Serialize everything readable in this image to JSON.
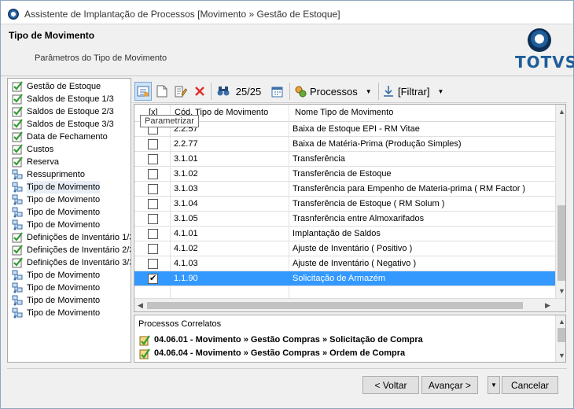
{
  "window": {
    "title": "Assistente de Implantação de Processos [Movimento » Gestão de Estoque]"
  },
  "header": {
    "title": "Tipo de Movimento",
    "subtitle": "Parâmetros do Tipo de Movimento",
    "logo_text": "TOTVS"
  },
  "steps": [
    {
      "label": "Gestão de Estoque",
      "icon": "check-icon"
    },
    {
      "label": "Saldos de Estoque 1/3",
      "icon": "check-icon"
    },
    {
      "label": "Saldos de Estoque 2/3",
      "icon": "check-icon"
    },
    {
      "label": "Saldos de Estoque 3/3",
      "icon": "check-icon"
    },
    {
      "label": "Data de Fechamento",
      "icon": "check-icon"
    },
    {
      "label": "Custos",
      "icon": "check-icon"
    },
    {
      "label": "Reserva",
      "icon": "check-icon"
    },
    {
      "label": "Ressuprimento",
      "icon": "step-icon"
    },
    {
      "label": "Tipo de Movimento",
      "icon": "step-icon",
      "active": true
    },
    {
      "label": "Tipo de Movimento",
      "icon": "step-icon"
    },
    {
      "label": "Tipo de Movimento",
      "icon": "step-icon"
    },
    {
      "label": "Tipo de Movimento",
      "icon": "step-icon"
    },
    {
      "label": "Definições de Inventário 1/3",
      "icon": "check-icon"
    },
    {
      "label": "Definições de Inventário 2/3",
      "icon": "check-icon"
    },
    {
      "label": "Definições de Inventário 3/3",
      "icon": "check-icon"
    },
    {
      "label": "Tipo de Movimento",
      "icon": "step-icon"
    },
    {
      "label": "Tipo de Movimento",
      "icon": "step-icon"
    },
    {
      "label": "Tipo de Movimento",
      "icon": "step-icon"
    },
    {
      "label": "Tipo de Movimento",
      "icon": "step-icon"
    }
  ],
  "toolbar": {
    "record_count": "25/25",
    "processos_label": "Processos",
    "filtrar_label": "[Filtrar]",
    "tooltip": "Parametrizar"
  },
  "grid": {
    "headers": {
      "check": "[x]",
      "code": "Cód. Tipo de Movimento",
      "name": "Nome Tipo de Movimento"
    },
    "rows": [
      {
        "checked": false,
        "code": "2.2.57",
        "name": "Baixa de Estoque EPI - RM Vitae"
      },
      {
        "checked": false,
        "code": "2.2.77",
        "name": "Baixa de Matéria-Prima (Produção Simples)"
      },
      {
        "checked": false,
        "code": "3.1.01",
        "name": "Transferência"
      },
      {
        "checked": false,
        "code": "3.1.02",
        "name": "Transferência de Estoque"
      },
      {
        "checked": false,
        "code": "3.1.03",
        "name": "Transferência para Empenho de Materia-prima ( RM Factor )"
      },
      {
        "checked": false,
        "code": "3.1.04",
        "name": "Transferência de Estoque ( RM Solum )"
      },
      {
        "checked": false,
        "code": "3.1.05",
        "name": "Trasnferência entre Almoxarifados"
      },
      {
        "checked": false,
        "code": "4.1.01",
        "name": "Implantação de Saldos"
      },
      {
        "checked": false,
        "code": "4.1.02",
        "name": "Ajuste de Inventário ( Positivo )"
      },
      {
        "checked": false,
        "code": "4.1.03",
        "name": "Ajuste de Inventário ( Negativo )"
      },
      {
        "checked": true,
        "code": "1.1.90",
        "name": "Solicitação de Armazém",
        "selected": true
      }
    ]
  },
  "related": {
    "title": "Processos Correlatos",
    "items": [
      "04.06.01 - Movimento » Gestão Compras » Solicitação de Compra",
      "04.06.04 - Movimento » Gestão Compras » Ordem de Compra"
    ]
  },
  "buttons": {
    "back": "< Voltar",
    "next": "Avançar >",
    "cancel": "Cancelar"
  },
  "colors": {
    "selection": "#3399ff",
    "brand": "#1f5d99",
    "check_green": "#2e9e2e"
  }
}
